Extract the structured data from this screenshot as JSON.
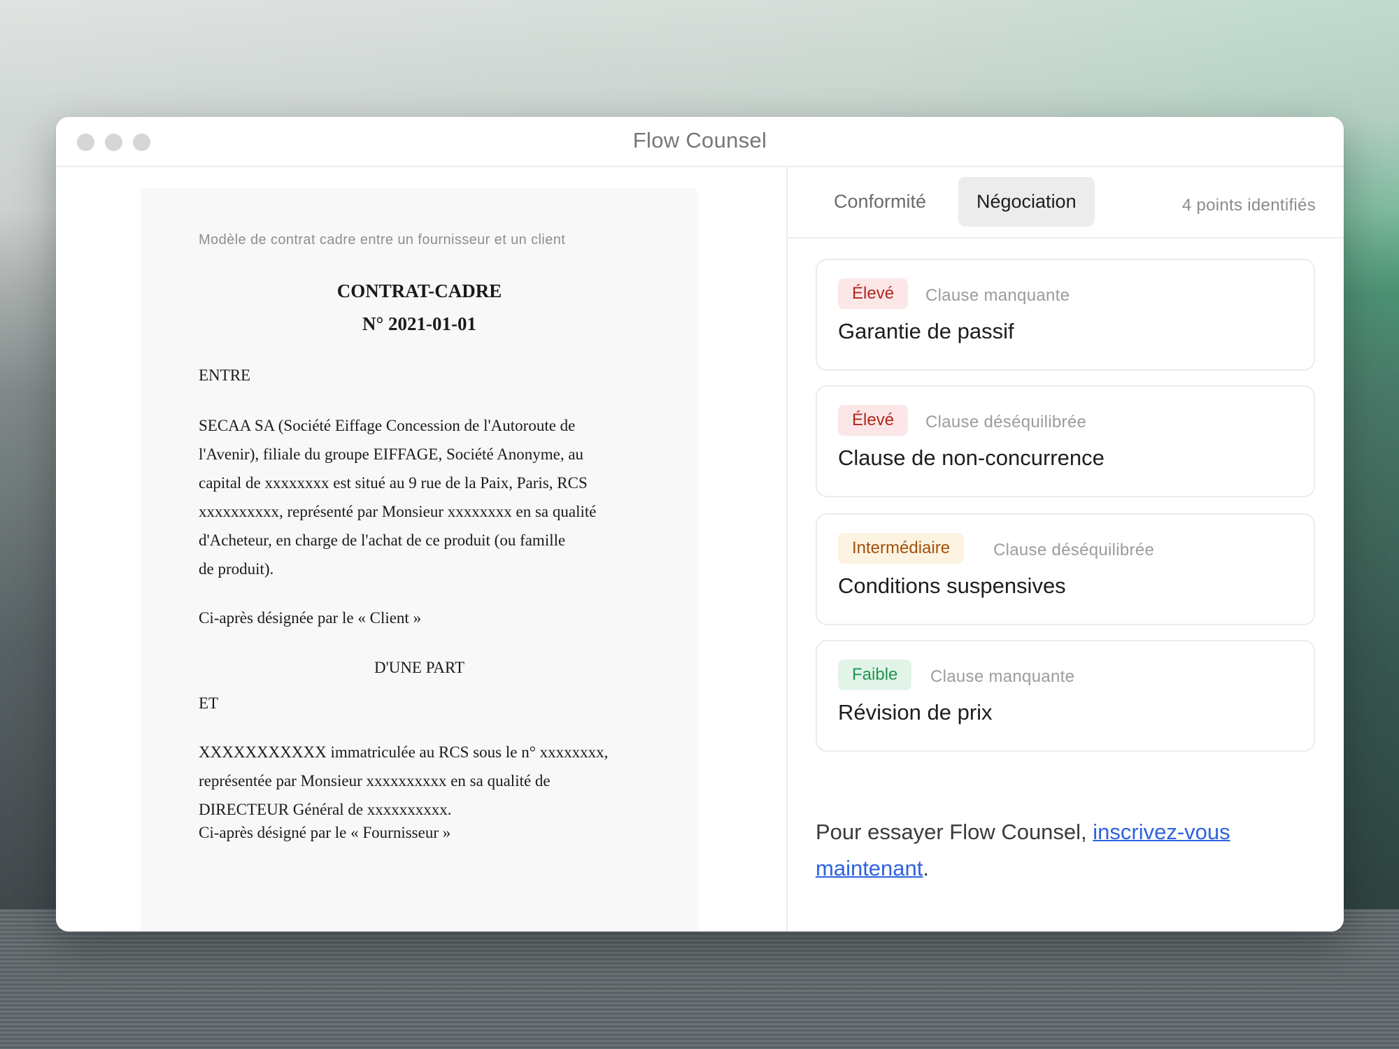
{
  "window": {
    "title": "Flow Counsel"
  },
  "document": {
    "note": "Modèle de contrat cadre entre un fournisseur et un client",
    "title_line1": "CONTRAT-CADRE",
    "title_line2": "N° 2021-01-01",
    "entre": "ENTRE",
    "party1_lines": [
      "SECAA SA (Société Eiffage Concession de l'Autoroute de",
      "l'Avenir), filiale du groupe EIFFAGE, Société Anonyme, au",
      "capital de xxxxxxxx est situé au 9 rue de la Paix, Paris, RCS",
      "xxxxxxxxxx, représenté par Monsieur xxxxxxxx en sa qualité",
      "d'Acheteur, en charge de l'achat de ce produit (ou famille",
      "de produit)."
    ],
    "client_designation": "Ci-après désignée par le « Client »",
    "dune_part": "D'UNE PART",
    "et": "ET",
    "party2_lines": [
      "XXXXXXXXXXX immatriculée au RCS sous le n° xxxxxxxx,",
      "représentée par Monsieur xxxxxxxxxx en sa qualité de",
      "DIRECTEUR Général de xxxxxxxxxx."
    ],
    "supplier_designation": "Ci-après désigné par le « Fournisseur »"
  },
  "tabs": [
    {
      "label": "Conformité",
      "active": false
    },
    {
      "label": "Négociation",
      "active": true
    }
  ],
  "points_count": "4 points identifiés",
  "cards": [
    {
      "severity": "Élevé",
      "severity_level": "high",
      "type": "Clause manquante",
      "title": "Garantie de passif"
    },
    {
      "severity": "Élevé",
      "severity_level": "high",
      "type": "Clause déséquilibrée",
      "title": "Clause de non-concurrence"
    },
    {
      "severity": "Intermédiaire",
      "severity_level": "medium",
      "type": "Clause déséquilibrée",
      "title": "Conditions suspensives"
    },
    {
      "severity": "Faible",
      "severity_level": "low",
      "type": "Clause manquante",
      "title": "Révision de prix"
    }
  ],
  "cta": {
    "prefix": "Pour essayer Flow Counsel, ",
    "link_text": "inscrivez-vous maintenant",
    "suffix": "."
  },
  "colors": {
    "severity_high": "#b3261e",
    "severity_medium": "#a0520f",
    "severity_low": "#1e9450",
    "link": "#2e62e0"
  }
}
